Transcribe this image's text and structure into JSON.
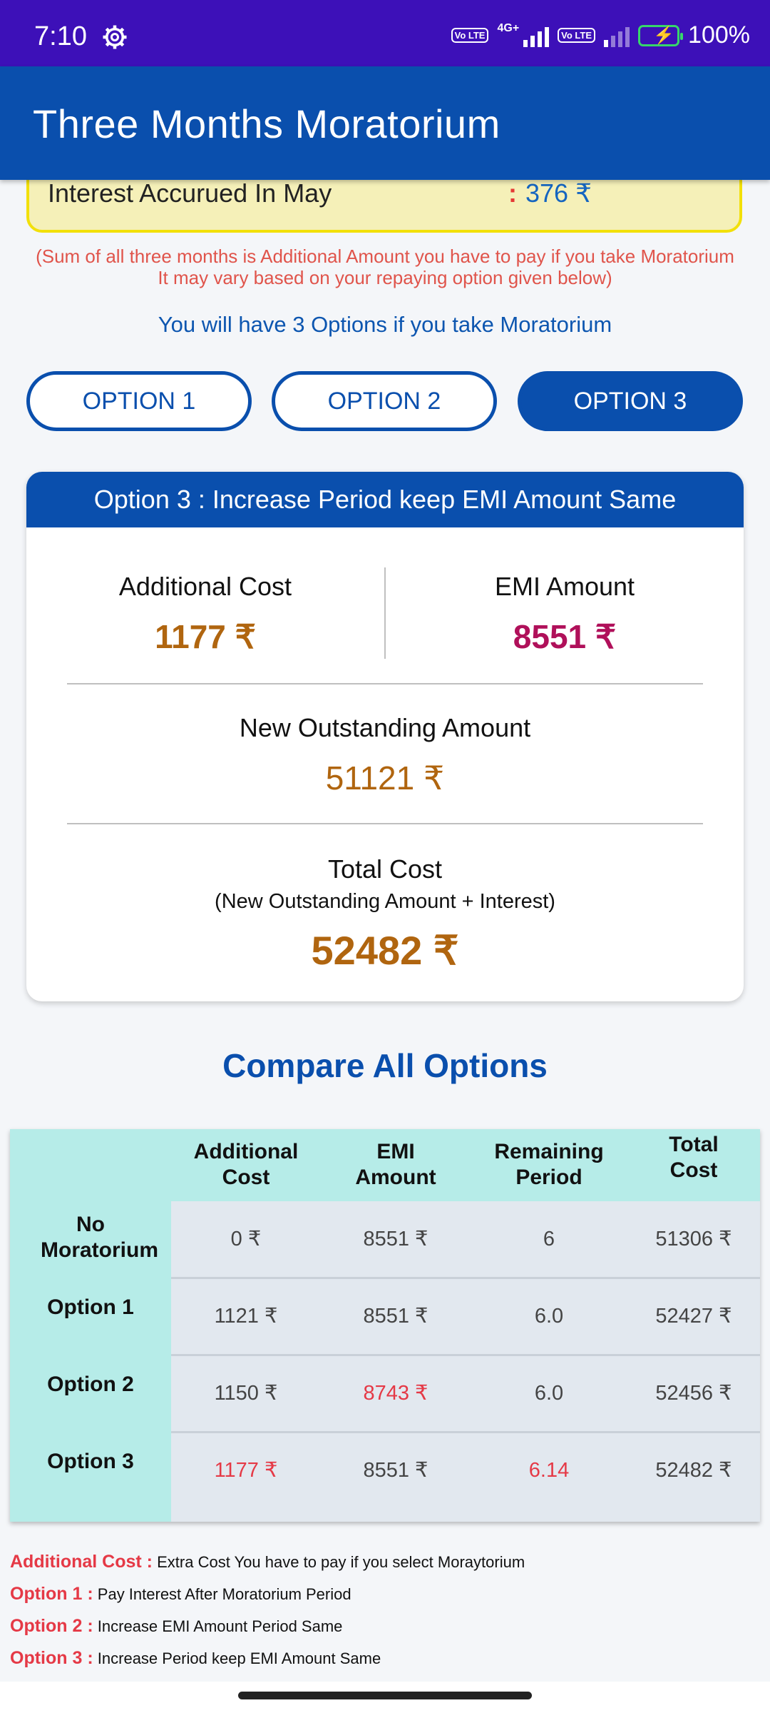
{
  "status_bar": {
    "time": "7:10",
    "network": "4G+",
    "volte1": "Vo LTE",
    "volte2": "Vo LTE",
    "battery": "100%",
    "icons": [
      "gear-icon",
      "signal-icon",
      "battery-icon"
    ]
  },
  "app_bar": {
    "title": "Three Months Moratorium"
  },
  "interest": {
    "label": "Interest Accurued In May",
    "colon": ":",
    "value": "376 ₹"
  },
  "note": {
    "line1": "(Sum of all three months is Additional Amount you have to pay if you take Moratorium",
    "line2": "It may vary based on your repaying option given below)"
  },
  "options_title": "You will have 3 Options if you take Moratorium",
  "option_buttons": [
    {
      "label": "OPTION 1",
      "active": false
    },
    {
      "label": "OPTION 2",
      "active": false
    },
    {
      "label": "OPTION 3",
      "active": true
    }
  ],
  "option_card": {
    "title": "Option 3 : Increase Period keep EMI Amount Same",
    "additional_cost_label": "Additional Cost",
    "additional_cost_value": "1177 ₹",
    "emi_label": "EMI Amount",
    "emi_value": "8551 ₹",
    "new_outstanding_label": "New Outstanding Amount",
    "new_outstanding_value": "51121 ₹",
    "total_cost_label": "Total Cost",
    "total_cost_sub": "(New Outstanding Amount + Interest)",
    "total_cost_value": "52482 ₹"
  },
  "compare": {
    "title": "Compare All Options",
    "headers": [
      "Additional\nCost",
      "EMI\nAmount",
      "Remaining\nPeriod",
      "Total\nCost"
    ],
    "rows": [
      {
        "name": "No Moratorium",
        "cells": [
          "0 ₹",
          "8551 ₹",
          "6",
          "51306 ₹"
        ]
      },
      {
        "name": "Option 1",
        "cells": [
          "1121 ₹",
          "8551 ₹",
          "6.0",
          "52427 ₹"
        ]
      },
      {
        "name": "Option 2",
        "cells": [
          "1150 ₹",
          "8743 ₹",
          "6.0",
          "52456 ₹"
        ]
      },
      {
        "name": "Option 3",
        "cells": [
          "1177 ₹",
          "8551 ₹",
          "6.14",
          "52482 ₹"
        ]
      }
    ]
  },
  "legend": [
    {
      "key": "Additional Cost :",
      "text": "Extra Cost You have to pay if you select Moraytorium"
    },
    {
      "key": "Option 1 :",
      "text": "Pay Interest After Moratorium Period"
    },
    {
      "key": "Option 2 :",
      "text": "Increase EMI Amount Period Same"
    },
    {
      "key": "Option 3 :",
      "text": "Increase Period keep EMI Amount Same"
    }
  ],
  "colors": {
    "status_bar": "#3d10b8",
    "app_bar": "#0a4fad",
    "cost_value": "#b0650f",
    "emi_value": "#b0105a",
    "highlight_red": "#e53946",
    "table_header": "#b6ece8"
  }
}
